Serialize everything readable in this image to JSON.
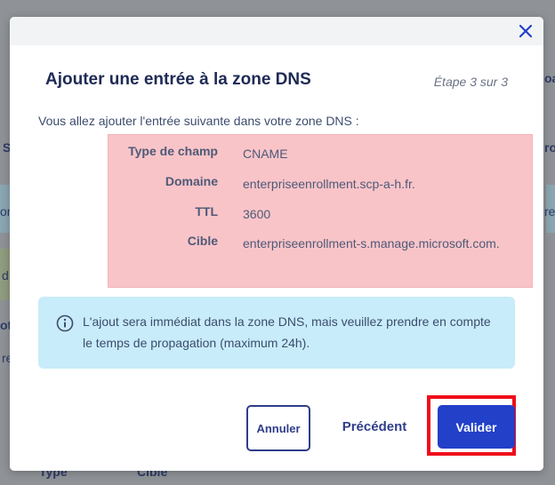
{
  "background": {
    "fragments": [
      "oa",
      "S",
      "ro",
      "re",
      "on",
      "d",
      "ot",
      "re",
      "Type",
      "Cible"
    ]
  },
  "modal": {
    "title": "Ajouter une entrée à la zone DNS",
    "step": "Étape 3 sur 3",
    "intro": "Vous allez ajouter l'entrée suivante dans votre zone DNS :",
    "entry": [
      {
        "key": "Type de champ",
        "value": "CNAME"
      },
      {
        "key": "Domaine",
        "value": "enterpriseenrollment.scp-a-h.fr."
      },
      {
        "key": "TTL",
        "value": "3600"
      },
      {
        "key": "Cible",
        "value": "enterpriseenrollment-s.manage.microsoft.com."
      }
    ],
    "info": "L'ajout sera immédiat dans la zone DNS, mais veuillez prendre en compte le temps de propagation (maximum 24h).",
    "buttons": {
      "cancel": "Annuler",
      "previous": "Précédent",
      "validate": "Valider"
    }
  },
  "icons": {
    "close": "close-icon",
    "info": "info-icon"
  },
  "colors": {
    "accent": "#2240c8",
    "highlight": "#ee0d1a",
    "entry_bg": "#f9c4c8",
    "info_bg": "#c8ecf9"
  }
}
